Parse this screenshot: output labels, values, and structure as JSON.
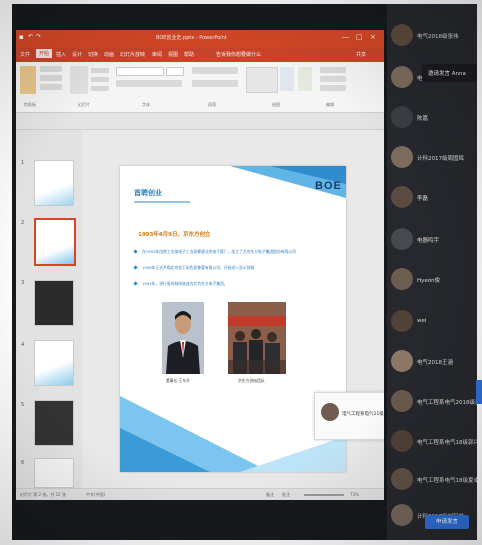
{
  "window": {
    "title": "BOE创业史.pptx - PowerPoint",
    "controls": [
      "—",
      "□",
      "×"
    ]
  },
  "menu": {
    "items": [
      "文件",
      "开始",
      "插入",
      "设计",
      "切换",
      "动画",
      "幻灯片放映",
      "审阅",
      "视图",
      "帮助"
    ],
    "active_index": 1,
    "tell_me": "告诉我你想要做什么",
    "share": "共享"
  },
  "ribbon": {
    "groups": [
      "剪贴板",
      "幻灯片",
      "字体",
      "段落",
      "绘图",
      "编辑"
    ]
  },
  "thumbnails": [
    {
      "number": "1"
    },
    {
      "number": "2"
    },
    {
      "number": "3"
    },
    {
      "number": "4"
    },
    {
      "number": "5"
    },
    {
      "number": "6"
    }
  ],
  "slide": {
    "title": "首聘创业",
    "logo": "BOE",
    "heading": "1993年4月9日，京东方创立",
    "bullets": [
      "在1993年由原工业部电子工业局筹建北京电子管厂，成立了北京东方电子集团股份有限公司",
      "1998年正式并购北京松下彩色显像管有限公司，开始进入显示领域",
      "1994年，进行股份制改造成为北京东方电子集团，"
    ],
    "captions": [
      "董事长 王东升",
      "京东方创始团队"
    ]
  },
  "status": {
    "slide_info": "幻灯片 第 2 张，共 12 张",
    "language": "中文(中国)",
    "notes": "备注",
    "comments": "批注",
    "zoom": "73%"
  },
  "presenter_chip": {
    "name": "电气工程系电气21级"
  },
  "participants": {
    "tooltip": "邀请发言 Anna",
    "list": [
      {
        "name": "电气2018级张伟",
        "color": "#5a4a3c"
      },
      {
        "name": "电气 Anna",
        "color": "#7c6b5e"
      },
      {
        "name": "陈嘉",
        "color": "#3c3e44"
      },
      {
        "name": "计科2017级周国辉",
        "color": "#7d6d5f"
      },
      {
        "name": "李磊",
        "color": "#5b4b40"
      },
      {
        "name": "电器鸣宇",
        "color": "#47494e"
      },
      {
        "name": "Hyeon俊",
        "color": "#6b5d50"
      },
      {
        "name": "wei",
        "color": "#504236"
      },
      {
        "name": "电气2018王涵",
        "color": "#8a7765"
      },
      {
        "name": "电气工程系电气2018级郭霖",
        "color": "#6a5a4d"
      },
      {
        "name": "电气工程系电气18级郭兴",
        "color": "#4f4238"
      },
      {
        "name": "电气工程系电气18级夏卓",
        "color": "#5f5145"
      },
      {
        "name": "计科2017级刘冠兰",
        "color": "#75665a"
      }
    ],
    "action_button": "申请发言"
  },
  "colors": {
    "ppt_accent": "#d24726",
    "panel_bg": "#26282d",
    "button_blue": "#2f6fd6"
  }
}
